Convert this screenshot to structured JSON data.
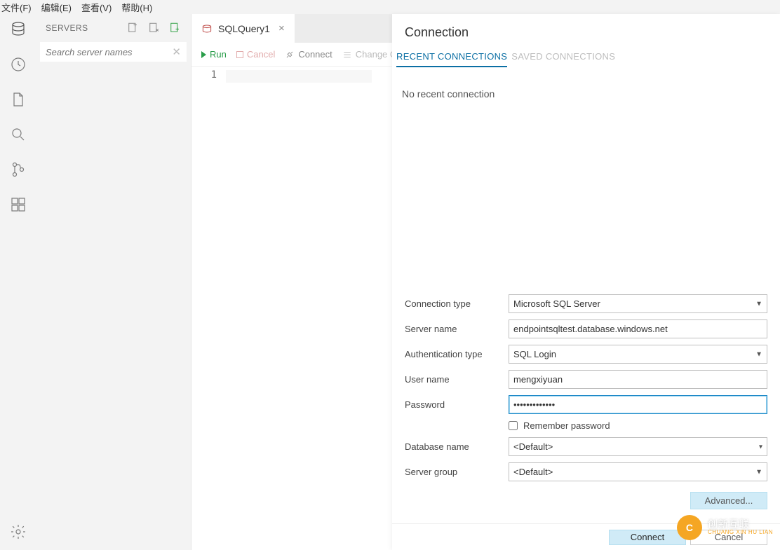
{
  "menu": {
    "file": "文件(F)",
    "edit": "编辑(E)",
    "view": "查看(V)",
    "help": "帮助(H)"
  },
  "sidebar": {
    "title": "SERVERS",
    "search_placeholder": "Search server names"
  },
  "tab": {
    "label": "SQLQuery1"
  },
  "toolbar": {
    "run": "Run",
    "cancel": "Cancel",
    "connect": "Connect",
    "change": "Change Co"
  },
  "editor": {
    "line_no": "1"
  },
  "panel": {
    "title": "Connection",
    "tab_recent": "RECENT CONNECTIONS",
    "tab_saved": "SAVED CONNECTIONS",
    "empty": "No recent connection",
    "labels": {
      "conn_type": "Connection type",
      "server_name": "Server name",
      "auth_type": "Authentication type",
      "user_name": "User name",
      "password": "Password",
      "remember": "Remember password",
      "db_name": "Database name",
      "server_group": "Server group"
    },
    "values": {
      "conn_type": "Microsoft SQL Server",
      "server_name": "endpointsqltest.database.windows.net",
      "auth_type": "SQL Login",
      "user_name": "mengxiyuan",
      "password": "•••••••••••••",
      "db_name": "<Default>",
      "server_group": "<Default>"
    },
    "advanced": "Advanced...",
    "connect_btn": "Connect",
    "cancel_btn": "Cancel"
  },
  "watermark": {
    "big": "创新互联",
    "small": "CHUANG XIN HU LIAN",
    "logo": "C"
  }
}
